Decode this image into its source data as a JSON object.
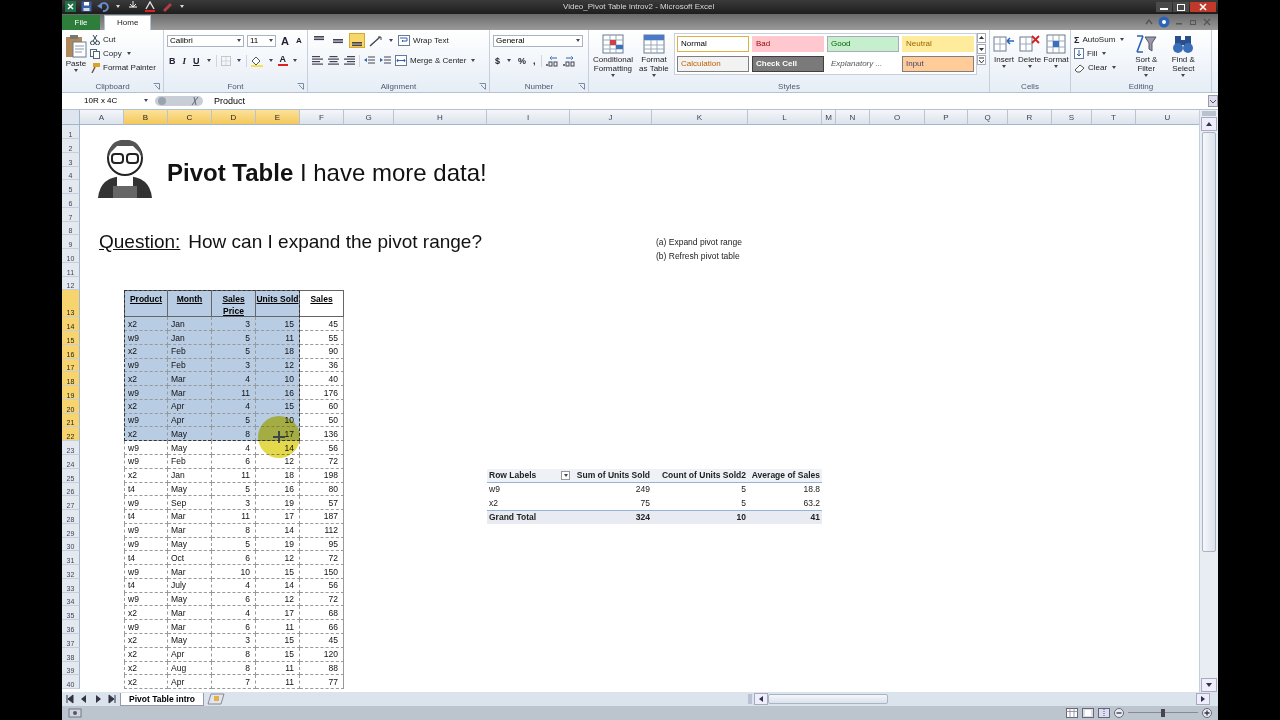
{
  "window": {
    "title": "Video_Pivot Table introv2 - Microsoft Excel"
  },
  "ribbon_tabs": [
    {
      "label": "File",
      "kind": "file",
      "selected": false
    },
    {
      "label": "Home",
      "kind": "tab",
      "selected": true
    }
  ],
  "clipboard": {
    "paste": "Paste",
    "cut": "Cut",
    "copy": "Copy",
    "format_painter": "Format Painter",
    "label": "Clipboard"
  },
  "font": {
    "name": "Calibri",
    "size": "11",
    "grow": "A",
    "shrink": "A",
    "bold": "B",
    "italic": "I",
    "underline": "U",
    "font_color": "A",
    "label": "Font"
  },
  "alignment": {
    "vertical": [
      {
        "selected": false
      },
      {
        "selected": false
      },
      {
        "selected": true
      }
    ],
    "wrap_text": "Wrap Text",
    "merge": "Merge & Center",
    "label": "Alignment"
  },
  "number": {
    "format": "General",
    "currency": "$",
    "percent": "%",
    "comma": ",",
    "label": "Number"
  },
  "styles": {
    "conditional": "Conditional Formatting",
    "format_table": "Format as Table",
    "label": "Styles",
    "cells": [
      {
        "label": "Normal",
        "kind": "normal"
      },
      {
        "label": "Bad",
        "kind": "bad"
      },
      {
        "label": "Good",
        "kind": "good"
      },
      {
        "label": "Neutral",
        "kind": "neutral"
      },
      {
        "label": "Calculation",
        "kind": "calculation"
      },
      {
        "label": "Check Cell",
        "kind": "check"
      },
      {
        "label": "Explanatory ...",
        "kind": "explanatory"
      },
      {
        "label": "Input",
        "kind": "input"
      }
    ]
  },
  "cells_group": {
    "buttons": [
      "Insert",
      "Delete",
      "Format"
    ],
    "label": "Cells"
  },
  "editing": {
    "autosum_symbol": "Σ",
    "autosum": "AutoSum",
    "fill": "Fill",
    "clear": "Clear",
    "sort": "Sort & Filter",
    "find": "Find & Select",
    "label": "Editing"
  },
  "formula_bar": {
    "name_box": "10R x 4C",
    "content": "Product"
  },
  "sheet": {
    "columns": [
      {
        "label": "A",
        "selected": false
      },
      {
        "label": "B",
        "selected": true
      },
      {
        "label": "C",
        "selected": true
      },
      {
        "label": "D",
        "selected": true
      },
      {
        "label": "E",
        "selected": true
      },
      {
        "label": "F",
        "selected": false
      },
      {
        "label": "G",
        "selected": false
      },
      {
        "label": "H",
        "selected": false
      },
      {
        "label": "I",
        "selected": false
      },
      {
        "label": "J",
        "selected": false
      },
      {
        "label": "K",
        "selected": false
      },
      {
        "label": "L",
        "selected": false
      },
      {
        "label": "M",
        "selected": false
      },
      {
        "label": "N",
        "selected": false
      },
      {
        "label": "O",
        "selected": false
      },
      {
        "label": "P",
        "selected": false
      },
      {
        "label": "Q",
        "selected": false
      },
      {
        "label": "R",
        "selected": false
      },
      {
        "label": "S",
        "selected": false
      },
      {
        "label": "T",
        "selected": false
      },
      {
        "label": "U",
        "selected": false
      }
    ],
    "rows": [
      {
        "label": "1",
        "selected": false
      },
      {
        "label": "2",
        "selected": false
      },
      {
        "label": "3",
        "selected": false
      },
      {
        "label": "4",
        "selected": false
      },
      {
        "label": "5",
        "selected": false
      },
      {
        "label": "6",
        "selected": false
      },
      {
        "label": "7",
        "selected": false
      },
      {
        "label": "8",
        "selected": false
      },
      {
        "label": "9",
        "selected": false
      },
      {
        "label": "10",
        "selected": false
      },
      {
        "label": "11",
        "selected": false
      },
      {
        "label": "12",
        "selected": false
      },
      {
        "label": "13",
        "selected": true
      },
      {
        "label": "14",
        "selected": true
      },
      {
        "label": "15",
        "selected": true
      },
      {
        "label": "16",
        "selected": true
      },
      {
        "label": "17",
        "selected": true
      },
      {
        "label": "18",
        "selected": true
      },
      {
        "label": "19",
        "selected": true
      },
      {
        "label": "20",
        "selected": true
      },
      {
        "label": "21",
        "selected": true
      },
      {
        "label": "22",
        "selected": true
      },
      {
        "label": "23",
        "selected": false
      },
      {
        "label": "24",
        "selected": false
      },
      {
        "label": "25",
        "selected": false
      },
      {
        "label": "26",
        "selected": false
      },
      {
        "label": "27",
        "selected": false
      },
      {
        "label": "28",
        "selected": false
      },
      {
        "label": "29",
        "selected": false
      },
      {
        "label": "30",
        "selected": false
      },
      {
        "label": "31",
        "selected": false
      },
      {
        "label": "32",
        "selected": false
      },
      {
        "label": "33",
        "selected": false
      },
      {
        "label": "34",
        "selected": false
      },
      {
        "label": "35",
        "selected": false
      },
      {
        "label": "36",
        "selected": false
      },
      {
        "label": "37",
        "selected": false
      },
      {
        "label": "38",
        "selected": false
      },
      {
        "label": "39",
        "selected": false
      },
      {
        "label": "40",
        "selected": false
      }
    ]
  },
  "title": "**Pivot Table** I have more data!",
  "question": {
    "label": "Question:",
    "text": "How can I expand the pivot range?"
  },
  "notes": [
    "(a) Expand pivot range",
    "(b) Refresh pivot table"
  ],
  "data_table": {
    "columns": [
      "Product",
      "Month",
      "Sales Price",
      "Units Sold",
      "Sales"
    ],
    "header_selected": true,
    "rows": [
      {
        "cells": [
          "x2",
          "Jan",
          "3",
          "15",
          "45"
        ],
        "selected": true
      },
      {
        "cells": [
          "w9",
          "Jan",
          "5",
          "11",
          "55"
        ],
        "selected": true
      },
      {
        "cells": [
          "x2",
          "Feb",
          "5",
          "18",
          "90"
        ],
        "selected": true
      },
      {
        "cells": [
          "w9",
          "Feb",
          "3",
          "12",
          "36"
        ],
        "selected": true
      },
      {
        "cells": [
          "x2",
          "Mar",
          "4",
          "10",
          "40"
        ],
        "selected": true
      },
      {
        "cells": [
          "w9",
          "Mar",
          "11",
          "16",
          "176"
        ],
        "selected": true
      },
      {
        "cells": [
          "x2",
          "Apr",
          "4",
          "15",
          "60"
        ],
        "selected": true
      },
      {
        "cells": [
          "w9",
          "Apr",
          "5",
          "10",
          "50"
        ],
        "selected": true
      },
      {
        "cells": [
          "x2",
          "May",
          "8",
          "17",
          "136"
        ],
        "selected": true
      },
      {
        "cells": [
          "w9",
          "May",
          "4",
          "14",
          "56"
        ],
        "selected": false
      },
      {
        "cells": [
          "w9",
          "Feb",
          "6",
          "12",
          "72"
        ],
        "selected": false
      },
      {
        "cells": [
          "x2",
          "Jan",
          "11",
          "18",
          "198"
        ],
        "selected": false
      },
      {
        "cells": [
          "t4",
          "May",
          "5",
          "16",
          "80"
        ],
        "selected": false
      },
      {
        "cells": [
          "w9",
          "Sep",
          "3",
          "19",
          "57"
        ],
        "selected": false
      },
      {
        "cells": [
          "t4",
          "Mar",
          "11",
          "17",
          "187"
        ],
        "selected": false
      },
      {
        "cells": [
          "w9",
          "Mar",
          "8",
          "14",
          "112"
        ],
        "selected": false
      },
      {
        "cells": [
          "w9",
          "May",
          "5",
          "19",
          "95"
        ],
        "selected": false
      },
      {
        "cells": [
          "t4",
          "Oct",
          "6",
          "12",
          "72"
        ],
        "selected": false
      },
      {
        "cells": [
          "w9",
          "Mar",
          "10",
          "15",
          "150"
        ],
        "selected": false
      },
      {
        "cells": [
          "t4",
          "July",
          "4",
          "14",
          "56"
        ],
        "selected": false
      },
      {
        "cells": [
          "w9",
          "May",
          "6",
          "12",
          "72"
        ],
        "selected": false
      },
      {
        "cells": [
          "x2",
          "Mar",
          "4",
          "17",
          "68"
        ],
        "selected": false
      },
      {
        "cells": [
          "w9",
          "Mar",
          "6",
          "11",
          "66"
        ],
        "selected": false
      },
      {
        "cells": [
          "x2",
          "May",
          "3",
          "15",
          "45"
        ],
        "selected": false
      },
      {
        "cells": [
          "x2",
          "Apr",
          "8",
          "15",
          "120"
        ],
        "selected": false
      },
      {
        "cells": [
          "x2",
          "Aug",
          "8",
          "11",
          "88"
        ],
        "selected": false
      },
      {
        "cells": [
          "x2",
          "Apr",
          "7",
          "11",
          "77"
        ],
        "selected": false
      }
    ]
  },
  "pivot": {
    "columns": [
      "Row Labels",
      "Sum of Units Sold",
      "Count of Units Sold2",
      "Average of Sales"
    ],
    "rows": [
      {
        "cells": [
          "w9",
          "249",
          "5",
          "18.8"
        ]
      },
      {
        "cells": [
          "x2",
          "75",
          "5",
          "63.2"
        ]
      }
    ],
    "total": {
      "cells": [
        "Grand Total",
        "324",
        "10",
        "41"
      ]
    }
  },
  "sheet_tabs": [
    {
      "label": "Pivot Table intro",
      "selected": true
    }
  ],
  "status_bar": {
    "zoom": {
      "level": 0.5
    }
  }
}
